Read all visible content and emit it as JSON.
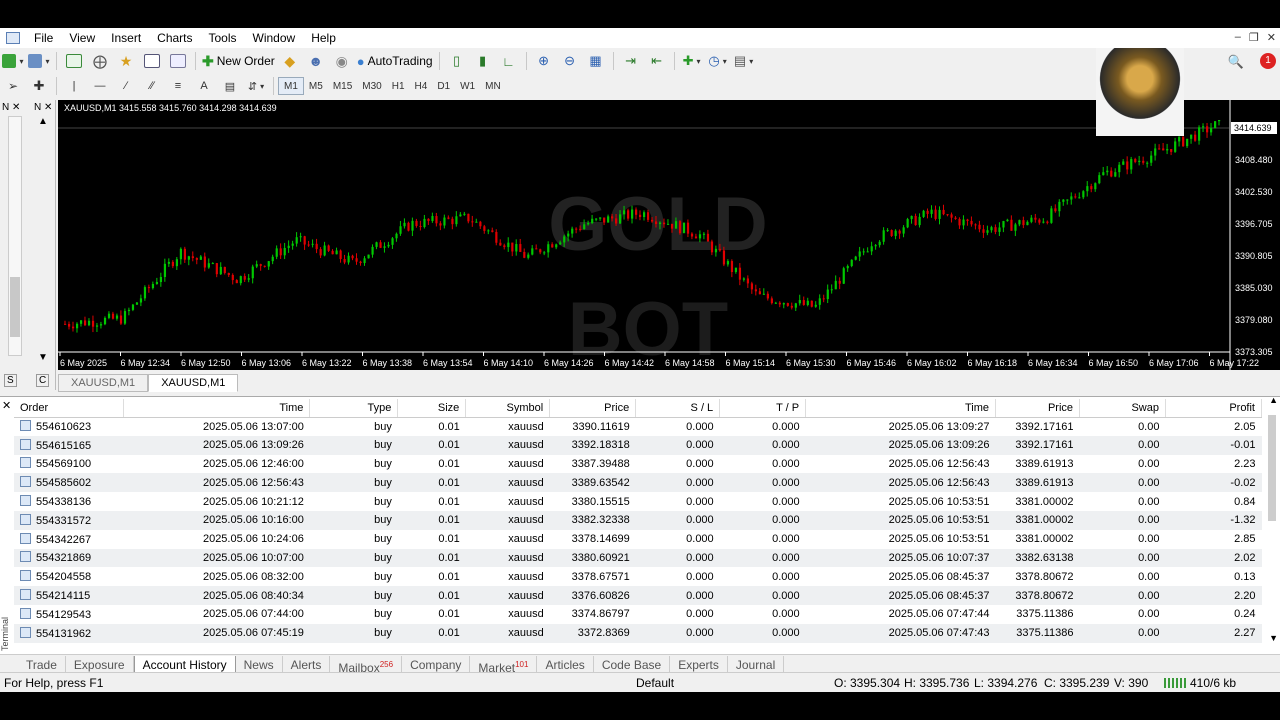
{
  "menu": [
    "File",
    "View",
    "Insert",
    "Charts",
    "Tools",
    "Window",
    "Help"
  ],
  "toolbar": {
    "new_order": "New Order",
    "autotrading": "AutoTrading",
    "timeframes": [
      "M1",
      "M5",
      "M15",
      "M30",
      "H1",
      "H4",
      "D1",
      "W1",
      "MN"
    ],
    "active_timeframe": "M1",
    "notification_count": "1"
  },
  "chart": {
    "header": "XAUUSD,M1  3415.558 3415.760 3414.298 3414.639",
    "watermark": [
      "GOLD",
      "BOT"
    ],
    "current_price_label": "3414.639",
    "tabs": [
      "XAUUSD,M1",
      "XAUUSD,M1"
    ],
    "active_tab": 1,
    "bull_color": "#00c800",
    "bear_color": "#e00000"
  },
  "chart_data": {
    "type": "candlestick",
    "symbol": "XAUUSD",
    "timeframe": "M1",
    "title": "XAUUSD,M1",
    "ohlc_last": {
      "open": 3415.558,
      "high": 3415.76,
      "low": 3414.298,
      "close": 3414.639
    },
    "ylim": [
      3373.305,
      3414.639
    ],
    "y_ticks": [
      "3414.639",
      "3408.480",
      "3402.530",
      "3396.705",
      "3390.805",
      "3385.030",
      "3379.080",
      "3373.305"
    ],
    "x_ticks": [
      "6 May 2025",
      "6 May 12:34",
      "6 May 12:50",
      "6 May 13:06",
      "6 May 13:22",
      "6 May 13:38",
      "6 May 13:54",
      "6 May 14:10",
      "6 May 14:26",
      "6 May 14:42",
      "6 May 14:58",
      "6 May 15:14",
      "6 May 15:30",
      "6 May 15:46",
      "6 May 16:02",
      "6 May 16:18",
      "6 May 16:34",
      "6 May 16:50",
      "6 May 17:06",
      "6 May 17:22"
    ],
    "close_trend": [
      3378,
      3379,
      3391,
      3386,
      3393,
      3389,
      3396,
      3397,
      3390,
      3396,
      3398,
      3394,
      3383,
      3381,
      3393,
      3398,
      3395,
      3397,
      3405,
      3409,
      3414
    ]
  },
  "terminal": {
    "columns": [
      "Order",
      "Time",
      "Type",
      "Size",
      "Symbol",
      "Price",
      "S / L",
      "T / P",
      "Time",
      "Price",
      "Swap",
      "Profit"
    ],
    "rows": [
      [
        "554610623",
        "2025.05.06 13:07:00",
        "buy",
        "0.01",
        "xauusd",
        "3390.11619",
        "0.000",
        "0.000",
        "2025.05.06 13:09:27",
        "3392.17161",
        "0.00",
        "2.05"
      ],
      [
        "554615165",
        "2025.05.06 13:09:26",
        "buy",
        "0.01",
        "xauusd",
        "3392.18318",
        "0.000",
        "0.000",
        "2025.05.06 13:09:26",
        "3392.17161",
        "0.00",
        "-0.01"
      ],
      [
        "554569100",
        "2025.05.06 12:46:00",
        "buy",
        "0.01",
        "xauusd",
        "3387.39488",
        "0.000",
        "0.000",
        "2025.05.06 12:56:43",
        "3389.61913",
        "0.00",
        "2.23"
      ],
      [
        "554585602",
        "2025.05.06 12:56:43",
        "buy",
        "0.01",
        "xauusd",
        "3389.63542",
        "0.000",
        "0.000",
        "2025.05.06 12:56:43",
        "3389.61913",
        "0.00",
        "-0.02"
      ],
      [
        "554338136",
        "2025.05.06 10:21:12",
        "buy",
        "0.01",
        "xauusd",
        "3380.15515",
        "0.000",
        "0.000",
        "2025.05.06 10:53:51",
        "3381.00002",
        "0.00",
        "0.84"
      ],
      [
        "554331572",
        "2025.05.06 10:16:00",
        "buy",
        "0.01",
        "xauusd",
        "3382.32338",
        "0.000",
        "0.000",
        "2025.05.06 10:53:51",
        "3381.00002",
        "0.00",
        "-1.32"
      ],
      [
        "554342267",
        "2025.05.06 10:24:06",
        "buy",
        "0.01",
        "xauusd",
        "3378.14699",
        "0.000",
        "0.000",
        "2025.05.06 10:53:51",
        "3381.00002",
        "0.00",
        "2.85"
      ],
      [
        "554321869",
        "2025.05.06 10:07:00",
        "buy",
        "0.01",
        "xauusd",
        "3380.60921",
        "0.000",
        "0.000",
        "2025.05.06 10:07:37",
        "3382.63138",
        "0.00",
        "2.02"
      ],
      [
        "554204558",
        "2025.05.06 08:32:00",
        "buy",
        "0.01",
        "xauusd",
        "3378.67571",
        "0.000",
        "0.000",
        "2025.05.06 08:45:37",
        "3378.80672",
        "0.00",
        "0.13"
      ],
      [
        "554214115",
        "2025.05.06 08:40:34",
        "buy",
        "0.01",
        "xauusd",
        "3376.60826",
        "0.000",
        "0.000",
        "2025.05.06 08:45:37",
        "3378.80672",
        "0.00",
        "2.20"
      ],
      [
        "554129543",
        "2025.05.06 07:44:00",
        "buy",
        "0.01",
        "xauusd",
        "3374.86797",
        "0.000",
        "0.000",
        "2025.05.06 07:47:44",
        "3375.11386",
        "0.00",
        "0.24"
      ],
      [
        "554131962",
        "2025.05.06 07:45:19",
        "buy",
        "0.01",
        "xauusd",
        "3372.8369",
        "0.000",
        "0.000",
        "2025.05.06 07:47:43",
        "3375.11386",
        "0.00",
        "2.27"
      ]
    ],
    "side_label": "Terminal"
  },
  "bottom_tabs": [
    {
      "label": "Trade",
      "badge": ""
    },
    {
      "label": "Exposure",
      "badge": ""
    },
    {
      "label": "Account History",
      "badge": ""
    },
    {
      "label": "News",
      "badge": ""
    },
    {
      "label": "Alerts",
      "badge": ""
    },
    {
      "label": "Mailbox",
      "badge": "256"
    },
    {
      "label": "Company",
      "badge": ""
    },
    {
      "label": "Market",
      "badge": "101"
    },
    {
      "label": "Articles",
      "badge": ""
    },
    {
      "label": "Code Base",
      "badge": ""
    },
    {
      "label": "Experts",
      "badge": ""
    },
    {
      "label": "Journal",
      "badge": ""
    }
  ],
  "active_bottom_tab": 2,
  "status": {
    "help": "For Help, press F1",
    "profile": "Default",
    "o": "O: 3395.304",
    "h": "H: 3395.736",
    "l": "L: 3394.276",
    "c": "C: 3395.239",
    "v": "V: 390",
    "traffic": "410/6 kb"
  }
}
